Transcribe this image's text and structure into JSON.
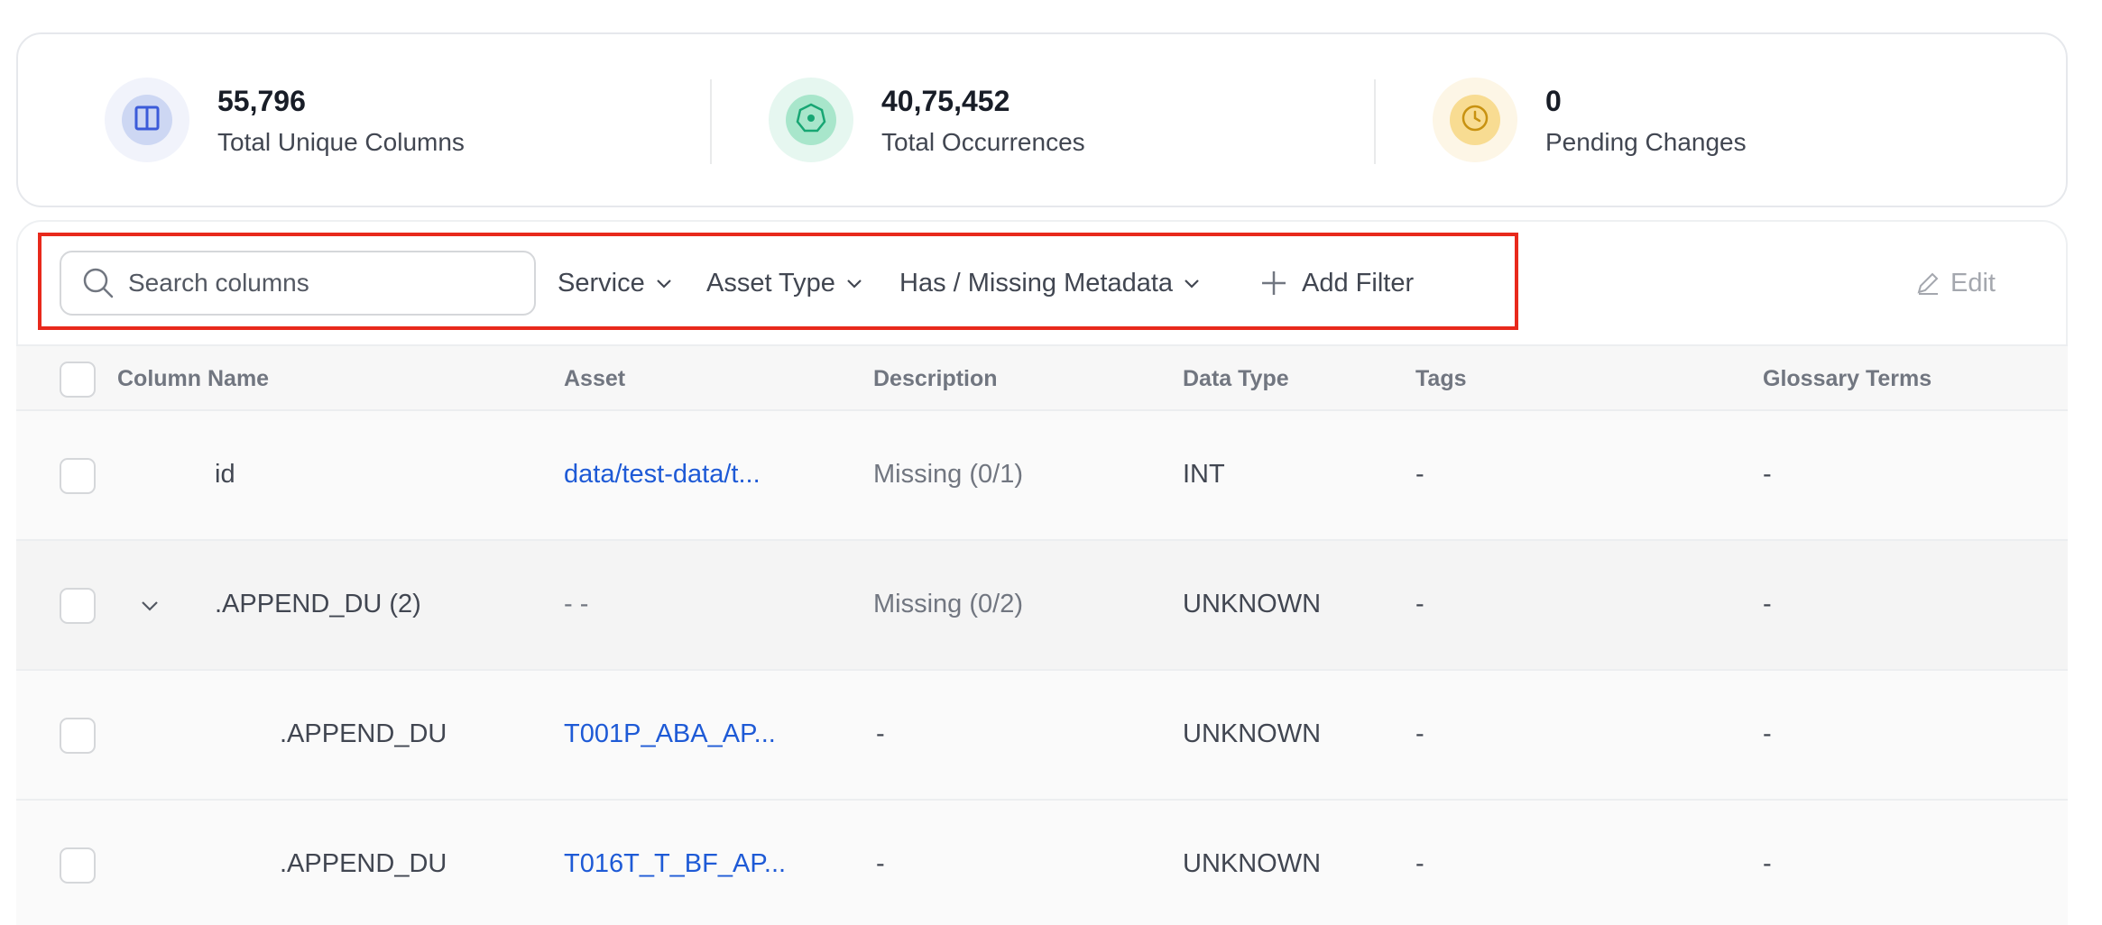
{
  "stats": [
    {
      "value": "55,796",
      "label": "Total Unique Columns",
      "icon": "columns-icon",
      "color": "#3b5bd9"
    },
    {
      "value": "40,75,452",
      "label": "Total Occurrences",
      "icon": "occurrences-icon",
      "color": "#17a673"
    },
    {
      "value": "0",
      "label": "Pending Changes",
      "icon": "clock-icon",
      "color": "#c89211"
    }
  ],
  "toolbar": {
    "search_placeholder": "Search columns",
    "filters": [
      "Service",
      "Asset Type",
      "Has / Missing Metadata"
    ],
    "add_filter_label": "Add Filter",
    "edit_label": "Edit"
  },
  "table": {
    "headers": [
      "Column Name",
      "Asset",
      "Description",
      "Data Type",
      "Tags",
      "Glossary Terms"
    ],
    "rows": [
      {
        "name": "id",
        "asset": "data/test-data/t...",
        "description": "Missing (0/1)",
        "data_type": "INT",
        "tags": "-",
        "glossary": "-"
      },
      {
        "name": ".APPEND_DU (2)",
        "asset": "- -",
        "description": "Missing (0/2)",
        "data_type": "UNKNOWN",
        "tags": "-",
        "glossary": "-"
      },
      {
        "name": ".APPEND_DU",
        "asset": "T001P_ABA_AP...",
        "description": "-",
        "data_type": "UNKNOWN",
        "tags": "-",
        "glossary": "-"
      },
      {
        "name": ".APPEND_DU",
        "asset": "T016T_T_BF_AP...",
        "description": "-",
        "data_type": "UNKNOWN",
        "tags": "-",
        "glossary": "-"
      }
    ]
  },
  "colors": {
    "accent_link": "#1e5ad6",
    "highlight_border": "#e8291c"
  }
}
